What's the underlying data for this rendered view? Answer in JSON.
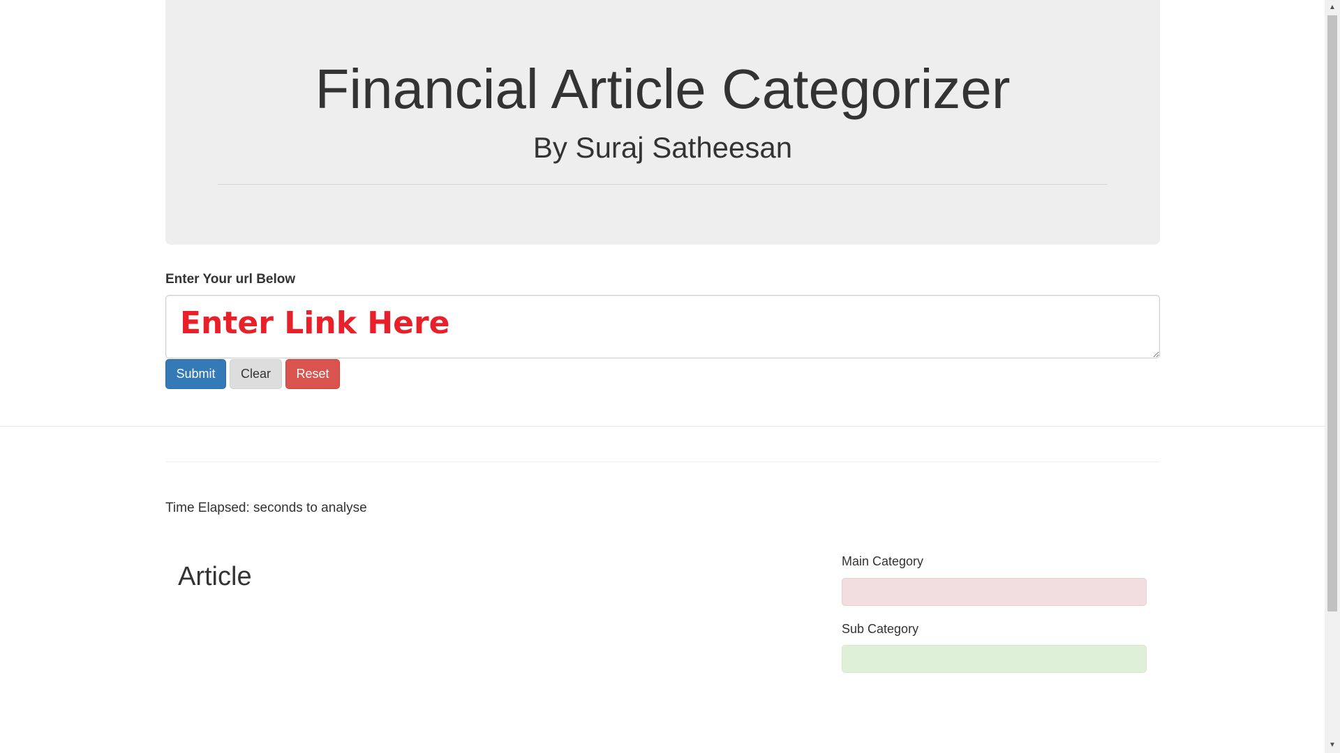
{
  "header": {
    "title": "Financial Article Categorizer",
    "subtitle": "By Suraj Satheesan"
  },
  "form": {
    "url_label": "Enter Your url Below",
    "url_placeholder": "Enter Link Here",
    "submit_label": "Submit",
    "clear_label": "Clear",
    "reset_label": "Reset"
  },
  "results": {
    "time_elapsed": "Time Elapsed: seconds to analyse",
    "article_heading": "Article",
    "main_category_label": "Main Category",
    "sub_category_label": "Sub Category",
    "main_category_value": "",
    "sub_category_value": ""
  },
  "colors": {
    "jumbotron_bg": "#eeeeee",
    "placeholder_red": "#e8202a",
    "submit_blue": "#337ab7",
    "clear_gray": "#dddddd",
    "reset_red": "#d9534f",
    "main_category_bg": "#f2dede",
    "sub_category_bg": "#dff0d8"
  },
  "scrollbar": {
    "up_icon": "triangle-up-icon",
    "down_icon": "triangle-down-icon"
  }
}
